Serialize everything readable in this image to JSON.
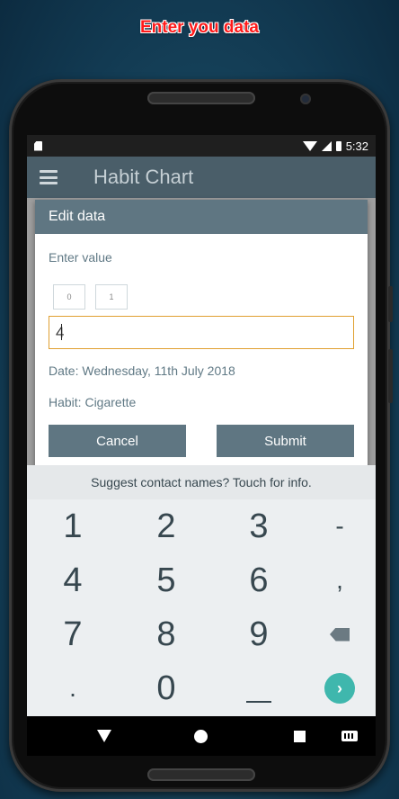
{
  "banner": "Enter you data",
  "status": {
    "time": "5:32"
  },
  "appbar": {
    "title": "Habit Chart"
  },
  "dialog": {
    "title": "Edit data",
    "enter_label": "Enter value",
    "recent_values": [
      "0",
      "1"
    ],
    "input_value": "4",
    "date_line": "Date: Wednesday, 11th July 2018",
    "habit_line": "Habit: Cigarette",
    "cancel_label": "Cancel",
    "submit_label": "Submit"
  },
  "suggestion": "Suggest contact names? Touch for info.",
  "keyboard": {
    "row1": [
      "1",
      "2",
      "3",
      "-"
    ],
    "row2": [
      "4",
      "5",
      "6",
      ","
    ],
    "row3": [
      "7",
      "8",
      "9"
    ],
    "row4": [
      ".",
      "0"
    ]
  },
  "colors": {
    "appbar": "#4a5e69",
    "dialog_header": "#5f7682",
    "input_focus_border": "#e0a030",
    "go_button": "#3fb7ad",
    "banner_text": "#ff1a1a"
  },
  "icons": {
    "menu": "hamburger-menu-icon",
    "backspace": "backspace-icon",
    "go": "chevron-right-icon",
    "nav_back": "triangle-back-icon",
    "nav_home": "circle-home-icon",
    "nav_recent": "square-recent-icon",
    "nav_keyboard": "keyboard-icon"
  }
}
